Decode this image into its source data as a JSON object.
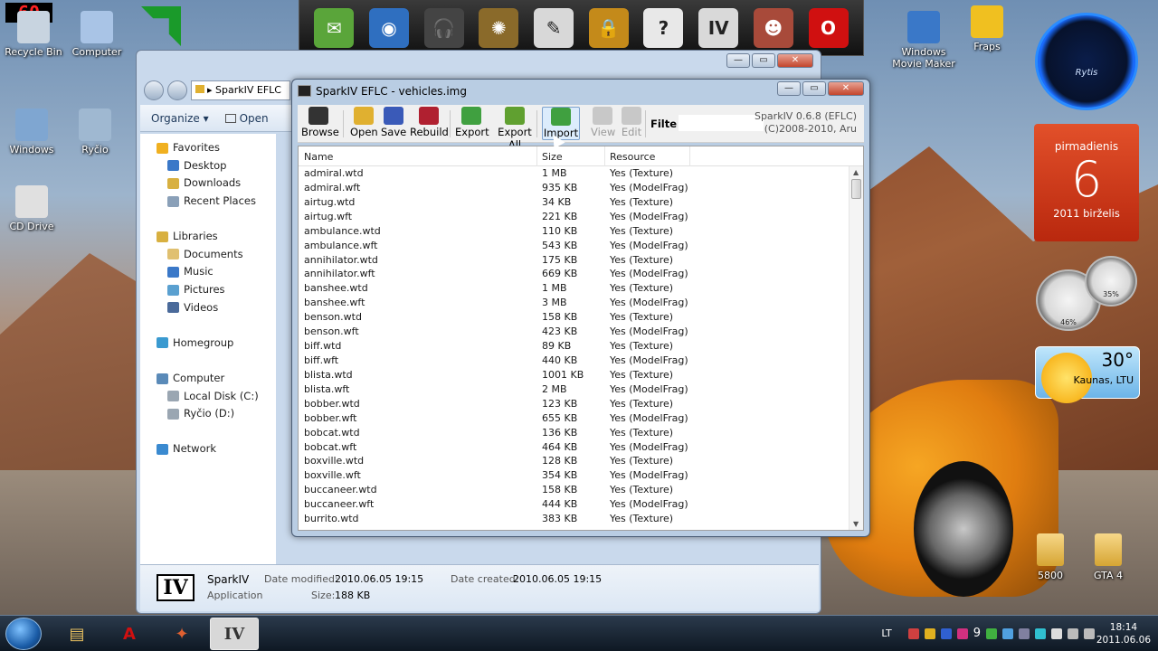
{
  "overlay": {
    "fps": "60"
  },
  "desktop_icons": [
    {
      "label": "Recycle Bin",
      "icon": "recycle-bin-icon"
    },
    {
      "label": "Computer",
      "icon": "computer-icon"
    },
    {
      "label": "Windows",
      "icon": "drive-icon"
    },
    {
      "label": "Ryčio",
      "icon": "drive-icon"
    },
    {
      "label": "CD Drive",
      "icon": "dvd-icon"
    },
    {
      "label": "Windows Movie Maker",
      "icon": "movie-maker-icon"
    },
    {
      "label": "Fraps",
      "icon": "fraps-icon"
    },
    {
      "label": "5800",
      "icon": "folder-icon"
    },
    {
      "label": "GTA 4",
      "icon": "folder-icon"
    }
  ],
  "dock_icons": [
    {
      "name": "mail-icon",
      "color": "#5aa53a",
      "glyph": "✉"
    },
    {
      "name": "globe-icon",
      "color": "#2f6fc0",
      "glyph": "◉"
    },
    {
      "name": "headphones-icon",
      "color": "#444444",
      "glyph": "🎧"
    },
    {
      "name": "film-reel-icon",
      "color": "#8a6a2a",
      "glyph": "✺"
    },
    {
      "name": "notepad-icon",
      "color": "#d8d8d8",
      "glyph": "✎"
    },
    {
      "name": "padlock-icon",
      "color": "#c48a1a",
      "glyph": "🔒"
    },
    {
      "name": "help-icon",
      "color": "#e8e8e8",
      "glyph": "?"
    },
    {
      "name": "gta-iv-icon",
      "color": "#d9d9d9",
      "glyph": "IV"
    },
    {
      "name": "gta-character-icon",
      "color": "#a84a3a",
      "glyph": "☻"
    },
    {
      "name": "opera-icon",
      "color": "#d01010",
      "glyph": "O"
    }
  ],
  "explorer": {
    "path": "SparkIV EFLC",
    "toolbar": {
      "organize": "Organize ▾",
      "open": "Open"
    },
    "nav": [
      {
        "label": "Favorites",
        "level": "top",
        "icon": "star-icon",
        "color": "#f0b020"
      },
      {
        "label": "Desktop",
        "level": "sub",
        "icon": "desktop-icon",
        "color": "#3a78c8"
      },
      {
        "label": "Downloads",
        "level": "sub",
        "icon": "downloads-icon",
        "color": "#d8b040"
      },
      {
        "label": "Recent Places",
        "level": "sub",
        "icon": "recent-places-icon",
        "color": "#8aa0b8"
      },
      {
        "label": "",
        "level": "gap"
      },
      {
        "label": "Libraries",
        "level": "top",
        "icon": "libraries-icon",
        "color": "#d8b040"
      },
      {
        "label": "Documents",
        "level": "sub",
        "icon": "documents-icon",
        "color": "#e0c070"
      },
      {
        "label": "Music",
        "level": "sub",
        "icon": "music-icon",
        "color": "#3a78c8"
      },
      {
        "label": "Pictures",
        "level": "sub",
        "icon": "pictures-icon",
        "color": "#5aa0d0"
      },
      {
        "label": "Videos",
        "level": "sub",
        "icon": "videos-icon",
        "color": "#4a6a9a"
      },
      {
        "label": "",
        "level": "gap"
      },
      {
        "label": "Homegroup",
        "level": "top",
        "icon": "homegroup-icon",
        "color": "#3a9ad0"
      },
      {
        "label": "",
        "level": "gap"
      },
      {
        "label": "Computer",
        "level": "top",
        "icon": "computer-icon",
        "color": "#5a8ab8"
      },
      {
        "label": "Local Disk (C:)",
        "level": "sub",
        "icon": "disk-icon",
        "color": "#9aa6b2"
      },
      {
        "label": "Ryčio (D:)",
        "level": "sub",
        "icon": "disk-icon",
        "color": "#9aa6b2"
      },
      {
        "label": "",
        "level": "gap"
      },
      {
        "label": "Network",
        "level": "top",
        "icon": "network-icon",
        "color": "#3a8ad0"
      }
    ],
    "details": {
      "name": "SparkIV",
      "type": "Application",
      "date_modified_label": "Date modified:",
      "date_modified": "2010.06.05 19:15",
      "date_created_label": "Date created:",
      "date_created": "2010.06.05 19:15",
      "size_label": "Size:",
      "size": "188 KB",
      "logo": "IV"
    }
  },
  "spark": {
    "title": "SparkIV EFLC - vehicles.img",
    "toolbar": [
      {
        "label": "Browse",
        "icon": "browse-icon",
        "color": "#333333",
        "state": "normal"
      },
      {
        "label": "Open",
        "icon": "open-folder-icon",
        "color": "#e0b030",
        "state": "normal"
      },
      {
        "label": "Save",
        "icon": "save-icon",
        "color": "#3a5ab8",
        "state": "normal"
      },
      {
        "label": "Rebuild",
        "icon": "rebuild-icon",
        "color": "#b02030",
        "state": "normal"
      },
      {
        "label": "Export",
        "icon": "export-icon",
        "color": "#40a040",
        "state": "normal"
      },
      {
        "label": "Export All",
        "icon": "export-all-icon",
        "color": "#60a030",
        "state": "normal"
      },
      {
        "label": "Import",
        "icon": "import-icon",
        "color": "#40a040",
        "state": "hover"
      },
      {
        "label": "View",
        "icon": "view-icon",
        "color": "#c8c8c8",
        "state": "disabled"
      },
      {
        "label": "Edit",
        "icon": "edit-icon",
        "color": "#c8c8c8",
        "state": "disabled"
      }
    ],
    "filter_label": "Filter:",
    "filter_value": "",
    "version_line1": "SparkIV 0.6.8 (EFLC)",
    "version_line2": "(C)2008-2010, Aru",
    "columns": [
      "Name",
      "Size",
      "Resource"
    ],
    "rows": [
      [
        "admiral.wtd",
        "1 MB",
        "Yes (Texture)"
      ],
      [
        "admiral.wft",
        "935 KB",
        "Yes (ModelFrag)"
      ],
      [
        "airtug.wtd",
        "34 KB",
        "Yes (Texture)"
      ],
      [
        "airtug.wft",
        "221 KB",
        "Yes (ModelFrag)"
      ],
      [
        "ambulance.wtd",
        "110 KB",
        "Yes (Texture)"
      ],
      [
        "ambulance.wft",
        "543 KB",
        "Yes (ModelFrag)"
      ],
      [
        "annihilator.wtd",
        "175 KB",
        "Yes (Texture)"
      ],
      [
        "annihilator.wft",
        "669 KB",
        "Yes (ModelFrag)"
      ],
      [
        "banshee.wtd",
        "1 MB",
        "Yes (Texture)"
      ],
      [
        "banshee.wft",
        "3 MB",
        "Yes (ModelFrag)"
      ],
      [
        "benson.wtd",
        "158 KB",
        "Yes (Texture)"
      ],
      [
        "benson.wft",
        "423 KB",
        "Yes (ModelFrag)"
      ],
      [
        "biff.wtd",
        "89 KB",
        "Yes (Texture)"
      ],
      [
        "biff.wft",
        "440 KB",
        "Yes (ModelFrag)"
      ],
      [
        "blista.wtd",
        "1001 KB",
        "Yes (Texture)"
      ],
      [
        "blista.wft",
        "2 MB",
        "Yes (ModelFrag)"
      ],
      [
        "bobber.wtd",
        "123 KB",
        "Yes (Texture)"
      ],
      [
        "bobber.wft",
        "655 KB",
        "Yes (ModelFrag)"
      ],
      [
        "bobcat.wtd",
        "136 KB",
        "Yes (Texture)"
      ],
      [
        "bobcat.wft",
        "464 KB",
        "Yes (ModelFrag)"
      ],
      [
        "boxville.wtd",
        "128 KB",
        "Yes (Texture)"
      ],
      [
        "boxville.wft",
        "354 KB",
        "Yes (ModelFrag)"
      ],
      [
        "buccaneer.wtd",
        "158 KB",
        "Yes (Texture)"
      ],
      [
        "buccaneer.wft",
        "444 KB",
        "Yes (ModelFrag)"
      ],
      [
        "burrito.wtd",
        "383 KB",
        "Yes (Texture)"
      ]
    ]
  },
  "gadgets": {
    "clock_label": "Rytis",
    "calendar": {
      "weekday": "pirmadienis",
      "day": "6",
      "year_month": "2011 birželis"
    },
    "meters": {
      "cpu": "46%",
      "ram": "35%"
    },
    "weather": {
      "temp": "30°",
      "location": "Kaunas, LTU"
    }
  },
  "taskbar": {
    "buttons": [
      {
        "name": "explorer-taskbar-button",
        "glyph": "▤",
        "color": "#e8c060",
        "active": false
      },
      {
        "name": "acrobat-taskbar-button",
        "glyph": "A",
        "color": "#d01010",
        "active": false
      },
      {
        "name": "app-taskbar-button",
        "glyph": "✦",
        "color": "#e06030",
        "active": false
      },
      {
        "name": "sparkiv-taskbar-button",
        "glyph": "IV",
        "color": "#333333",
        "active": true
      }
    ],
    "language": "LT",
    "tray_number": "9",
    "time": "18:14",
    "date": "2011.06.06"
  }
}
